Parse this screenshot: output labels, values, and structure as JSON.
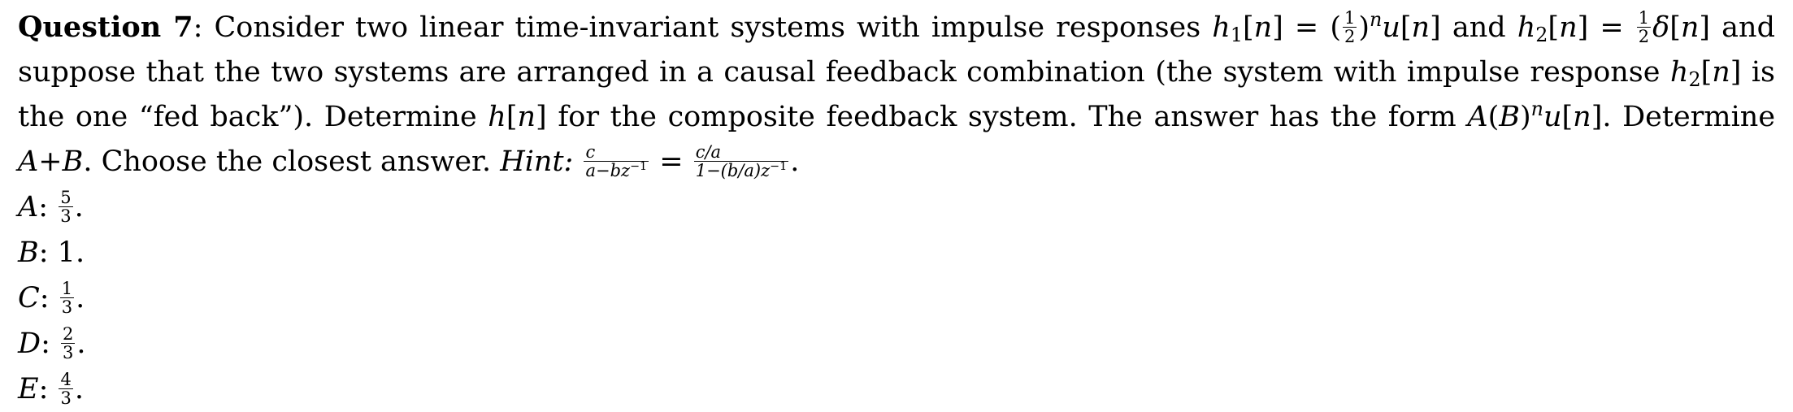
{
  "question": {
    "title": "Question 7",
    "lead": "Consider two linear time-invariant systems with impulse responses",
    "and1": "and",
    "and2": "and suppose that the two systems are arranged in a causal feedback combination (the system with impulse response",
    "fedback": "is the one “fed back”). Determine",
    "for_the": "for the composite feedback system. The answer has the form",
    "determine2": "Determine",
    "choose": "Choose the closest answer.",
    "hint_label": "Hint:"
  },
  "math": {
    "h": "h",
    "n": "n",
    "u": "u",
    "delta": "δ",
    "one": "1",
    "two": "2",
    "A": "A",
    "B": "B",
    "c": "c",
    "ca": "c/a",
    "hint_den_left": "a−bz",
    "hint_den_right": "1−(b/a)z",
    "neg_one": "−1"
  },
  "options": [
    {
      "letter": "A",
      "num": "5",
      "den": "3"
    },
    {
      "letter": "B",
      "value": "1"
    },
    {
      "letter": "C",
      "num": "1",
      "den": "3"
    },
    {
      "letter": "D",
      "num": "2",
      "den": "3"
    },
    {
      "letter": "E",
      "num": "4",
      "den": "3"
    }
  ]
}
